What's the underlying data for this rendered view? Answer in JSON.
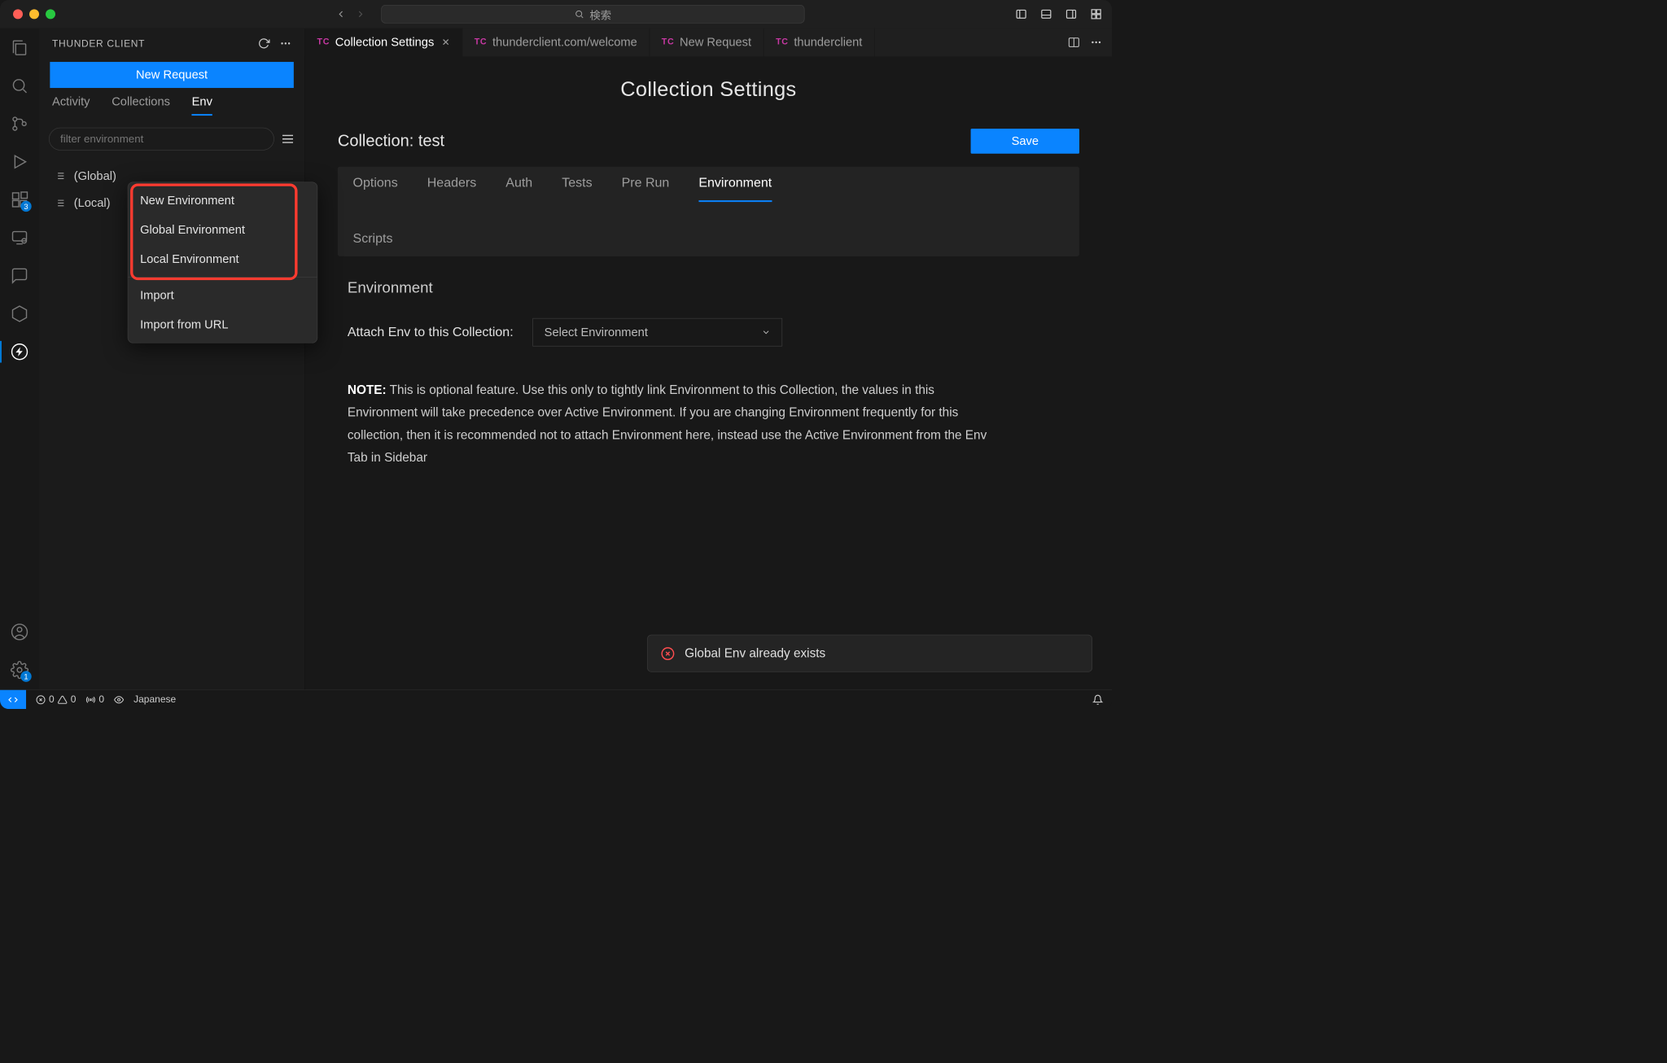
{
  "search_placeholder": "検索",
  "sidebar": {
    "title": "THUNDER CLIENT",
    "new_request_btn": "New Request",
    "tabs": {
      "activity": "Activity",
      "collections": "Collections",
      "env": "Env"
    },
    "filter_placeholder": "filter environment",
    "env_items": [
      "(Global)",
      "(Local)"
    ]
  },
  "ctxmenu": {
    "new_env": "New Environment",
    "global_env": "Global Environment",
    "local_env": "Local Environment",
    "import": "Import",
    "import_url": "Import from URL"
  },
  "editor_tabs": [
    {
      "label": "Collection Settings",
      "active": true,
      "closable": true,
      "prefix": "TC"
    },
    {
      "label": "thunderclient.com/welcome",
      "active": false,
      "closable": false,
      "prefix": "TC"
    },
    {
      "label": "New Request",
      "active": false,
      "closable": false,
      "prefix": "TC"
    },
    {
      "label": "thunderclient",
      "active": false,
      "closable": false,
      "prefix": "TC"
    }
  ],
  "activity_badges": {
    "extensions": "3",
    "settings": "1"
  },
  "content": {
    "page_title": "Collection Settings",
    "collection_label": "Collection: test",
    "save": "Save",
    "tabs": [
      "Options",
      "Headers",
      "Auth",
      "Tests",
      "Pre Run",
      "Environment",
      "Scripts"
    ],
    "active_tab": "Environment",
    "section_title": "Environment",
    "attach_label": "Attach Env to this Collection:",
    "select_placeholder": "Select Environment",
    "note_label": "NOTE:",
    "note_text": "This is optional feature. Use this only to tightly link Environment to this Collection, the values in this Environment will take precedence over Active Environment. If you are changing Environment frequently for this collection, then it is recommended not to attach Environment here, instead use the Active Environment from the Env Tab in Sidebar",
    "toast": "Global Env already exists"
  },
  "statusbar": {
    "errors": "0",
    "warnings": "0",
    "radio": "0",
    "lang": "Japanese"
  }
}
